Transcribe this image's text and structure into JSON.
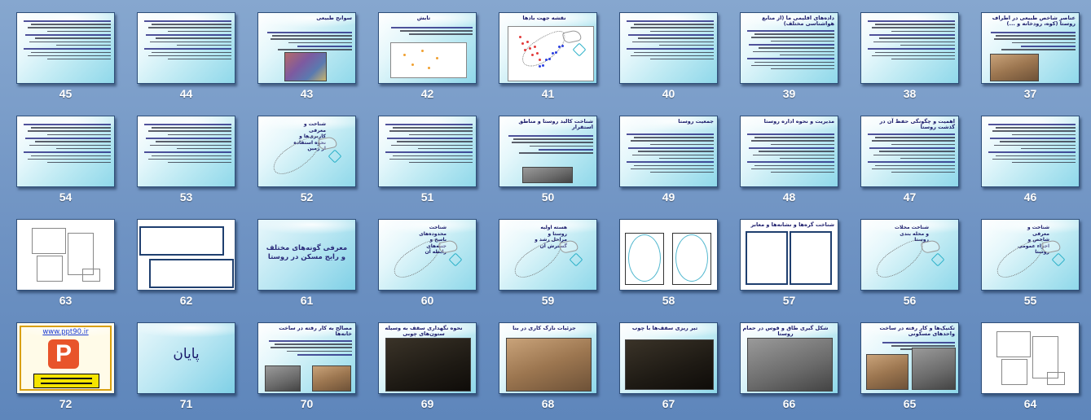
{
  "view": "slide-sorter",
  "rows": [
    [
      {
        "num": "45",
        "title": "",
        "kind": "text"
      },
      {
        "num": "44",
        "title": "",
        "kind": "text"
      },
      {
        "num": "43",
        "title": "سوانح طبیعی",
        "kind": "text-photo"
      },
      {
        "num": "42",
        "title": "تابش",
        "kind": "text-diagram"
      },
      {
        "num": "41",
        "title": "نقشه جهت بادها",
        "kind": "map-dots"
      },
      {
        "num": "40",
        "title": "",
        "kind": "text"
      },
      {
        "num": "39",
        "title": "داده‌های اقلیمی ما (از منابع هواشناسی مختلف)",
        "kind": "text"
      },
      {
        "num": "38",
        "title": "",
        "kind": "text"
      },
      {
        "num": "37",
        "title": "عناصر شاخص طبیعی در اطراف روستا (کوه، رودخانه و ...)",
        "kind": "text-photo"
      }
    ],
    [
      {
        "num": "54",
        "title": "",
        "kind": "text"
      },
      {
        "num": "53",
        "title": "",
        "kind": "text"
      },
      {
        "num": "52",
        "title": "شناخت و معرفی کاربری‌ها و نحوه استفاده از زمین",
        "kind": "map"
      },
      {
        "num": "51",
        "title": "",
        "kind": "text"
      },
      {
        "num": "50",
        "title": "شناخت کالبد روستا و مناطق استقرار",
        "kind": "text-photo"
      },
      {
        "num": "49",
        "title": "جمعیت روستا",
        "kind": "text"
      },
      {
        "num": "48",
        "title": "مدیریت و نحوه اداره روستا",
        "kind": "text"
      },
      {
        "num": "47",
        "title": "اهمیت و چگونگی حفظ آن در گذشت روستا",
        "kind": "text"
      },
      {
        "num": "46",
        "title": "",
        "kind": "text"
      }
    ],
    [
      {
        "num": "63",
        "title": "",
        "kind": "drawing"
      },
      {
        "num": "62",
        "title": "",
        "kind": "two-frames"
      },
      {
        "num": "61",
        "title": "معرفی گونه‌های مختلف و رایج مسکن در روستا",
        "kind": "title"
      },
      {
        "num": "60",
        "title": "شناخت محدوده‌های پاسخ و جنبه‌های رابطه آن",
        "kind": "map"
      },
      {
        "num": "59",
        "title": "هسته اولیه روستا و مراحل رشد و گسترش آن",
        "kind": "map"
      },
      {
        "num": "58",
        "title": "",
        "kind": "two-ellipses"
      },
      {
        "num": "57",
        "title": "شناخت گره‌ها و نشانه‌ها و معابر",
        "kind": "map-pair"
      },
      {
        "num": "56",
        "title": "شناخت محلات و محله بندی روستا",
        "kind": "map"
      },
      {
        "num": "55",
        "title": "شناخت و معرفی شاخص و اجزاء عمومی روستا",
        "kind": "map"
      }
    ],
    [
      {
        "num": "72",
        "title": "www.ppt90.ir",
        "kind": "logo"
      },
      {
        "num": "71",
        "title": "پایان",
        "kind": "end"
      },
      {
        "num": "70",
        "title": "مصالح به کار رفته در ساخت خانه‌ها",
        "kind": "text-photos"
      },
      {
        "num": "69",
        "title": "نحوه نگهداری سقف به وسیله ستون‌های چوبی",
        "kind": "photo"
      },
      {
        "num": "68",
        "title": "جزئیات نازک کاری در بنا",
        "kind": "photo"
      },
      {
        "num": "67",
        "title": "تیر ریزی سقف‌ها با چوب",
        "kind": "photo-dark"
      },
      {
        "num": "66",
        "title": "شکل گیری طاق و قوس در حمام روستا",
        "kind": "photo"
      },
      {
        "num": "65",
        "title": "تکنیک‌ها و کار رفته در ساخت واحدهای مسکونی",
        "kind": "text-photos"
      },
      {
        "num": "64",
        "title": "",
        "kind": "drawing"
      }
    ]
  ]
}
